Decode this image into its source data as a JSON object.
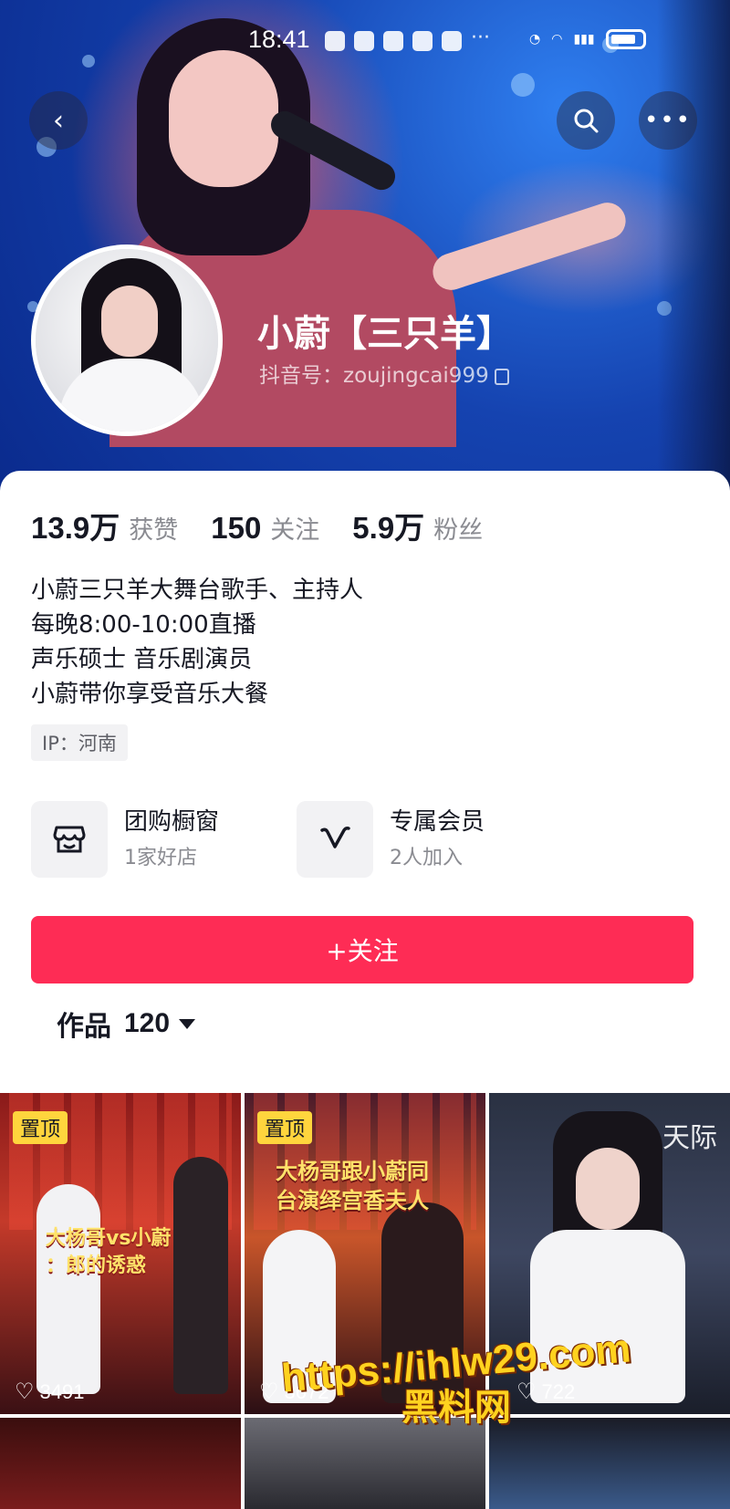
{
  "status": {
    "time": "18:41",
    "dots": "···"
  },
  "profile": {
    "name": "小蔚【三只羊】",
    "douyin_id": "抖音号：zoujingcai999"
  },
  "stats": [
    {
      "value": "13.9万",
      "label": "获赞"
    },
    {
      "value": "150",
      "label": "关注"
    },
    {
      "value": "5.9万",
      "label": "粉丝"
    }
  ],
  "bio": [
    "小蔚三只羊大舞台歌手、主持人",
    "每晚8:00-10:00直播",
    "声乐硕士 音乐剧演员",
    "小蔚带你享受音乐大餐"
  ],
  "ip": "IP：河南",
  "features": [
    {
      "title": "团购橱窗",
      "subtitle": "1家好店",
      "icon": "shop-icon"
    },
    {
      "title": "专属会员",
      "subtitle": "2人加入",
      "icon": "v-icon"
    }
  ],
  "follow_label": "+关注",
  "works": {
    "label": "作品",
    "count": "120"
  },
  "videos": [
    {
      "pinned": "置顶",
      "caption": "大杨哥vs小蔚\n：郎的诱惑",
      "likes": "3491"
    },
    {
      "pinned": "置顶",
      "caption": "大杨哥跟小蔚同\n台演绎宫香夫人",
      "likes": "3672"
    },
    {
      "side_text": "天际",
      "likes": "722"
    }
  ],
  "watermark": {
    "line1": "https://ihlw29.com",
    "line2": "黑料网"
  },
  "colors": {
    "accent": "#fe2c55",
    "pin": "#ffd53d",
    "banner": "#1543b0"
  }
}
